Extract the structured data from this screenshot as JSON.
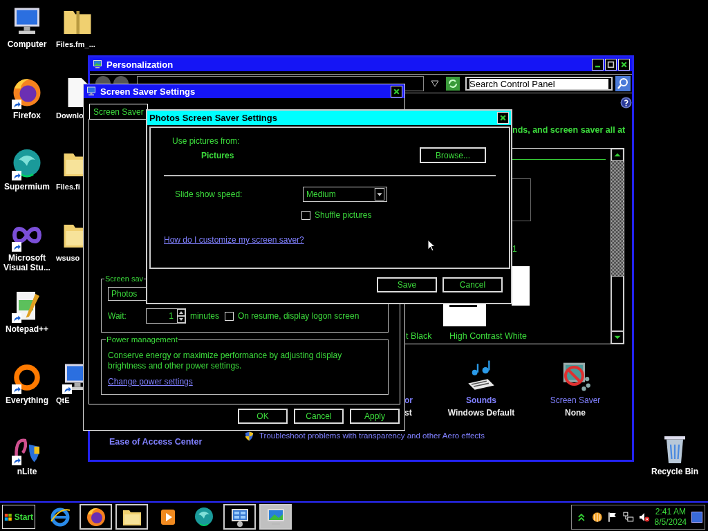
{
  "desktop_icons": [
    {
      "label": "Computer",
      "kind": "computer",
      "shortcut": false
    },
    {
      "label": "Firefox",
      "kind": "firefox",
      "shortcut": true
    },
    {
      "label": "Supermium",
      "kind": "supermium",
      "shortcut": true
    },
    {
      "label": "Microsoft Visual Stu...",
      "kind": "visual-studio",
      "shortcut": true
    },
    {
      "label": "Notepad++",
      "kind": "notepad",
      "shortcut": true
    },
    {
      "label": "Everything",
      "kind": "everything",
      "shortcut": true
    },
    {
      "label": "nLite",
      "kind": "nlite",
      "shortcut": true
    },
    {
      "label": "Files.fm_...",
      "kind": "zip-folder",
      "shortcut": false
    },
    {
      "label": "Downlo",
      "kind": "document",
      "shortcut": false
    },
    {
      "label": "Files.fi",
      "kind": "folder",
      "shortcut": false
    },
    {
      "label": "wsuso",
      "kind": "folder",
      "shortcut": false
    },
    {
      "label": "QtE",
      "kind": "qt",
      "shortcut": true
    },
    {
      "label": "Recycle Bin",
      "kind": "recycle-bin",
      "shortcut": false
    }
  ],
  "personalization_window": {
    "title": "Personalization",
    "search_placeholder": "Search Control Panel",
    "intro_fragment": "nds, and screen saver all at",
    "theme_fragment": "1",
    "themes": [
      {
        "label": "t Black"
      },
      {
        "label": "High Contrast White"
      }
    ],
    "items": [
      {
        "kind": "color",
        "label": "or",
        "value": "st"
      },
      {
        "kind": "sounds",
        "label": "Sounds",
        "value": "Windows Default"
      },
      {
        "kind": "screen-saver",
        "label": "Screen Saver",
        "value": "None"
      }
    ],
    "see_also": "Ease of Access Center",
    "troubleshoot_link": "Troubleshoot problems with transparency and other Aero effects"
  },
  "screen_saver_dialog": {
    "title": "Screen Saver Settings",
    "tabs": [
      {
        "label": "Screen Saver",
        "selected": true
      }
    ],
    "group_title": "Screen sav",
    "screen_saver": "Photos",
    "wait_label": "Wait:",
    "wait_value": "1",
    "wait_unit": "minutes",
    "logon_checkbox": {
      "label": "On resume, display logon screen",
      "checked": false
    },
    "power": {
      "title": "Power management",
      "text": "Conserve energy or maximize performance by adjusting display brightness and other power settings.",
      "link": "Change power settings"
    },
    "buttons": [
      "OK",
      "Cancel",
      "Apply"
    ]
  },
  "photos_dialog": {
    "title": "Photos Screen Saver Settings",
    "source_label": "Use pictures from:",
    "source": "Pictures",
    "browse": "Browse...",
    "speed_label": "Slide show speed:",
    "speed": "Medium",
    "shuffle": {
      "label": "Shuffle pictures",
      "checked": false
    },
    "help_link": "How do I customize my screen saver?",
    "buttons": [
      "Save",
      "Cancel"
    ]
  },
  "taskbar": {
    "start": "Start",
    "items": [
      {
        "kind": "ie",
        "open": false,
        "selected": false
      },
      {
        "kind": "firefox",
        "open": true,
        "selected": false
      },
      {
        "kind": "explorer",
        "open": true,
        "selected": false
      },
      {
        "kind": "media-player",
        "open": false,
        "selected": false
      },
      {
        "kind": "supermium",
        "open": false,
        "selected": false
      },
      {
        "kind": "control-panel",
        "open": true,
        "selected": false
      },
      {
        "kind": "personalization",
        "open": true,
        "selected": true
      }
    ],
    "clock": {
      "time": "2:41 AM",
      "date": "8/5/2024"
    }
  }
}
